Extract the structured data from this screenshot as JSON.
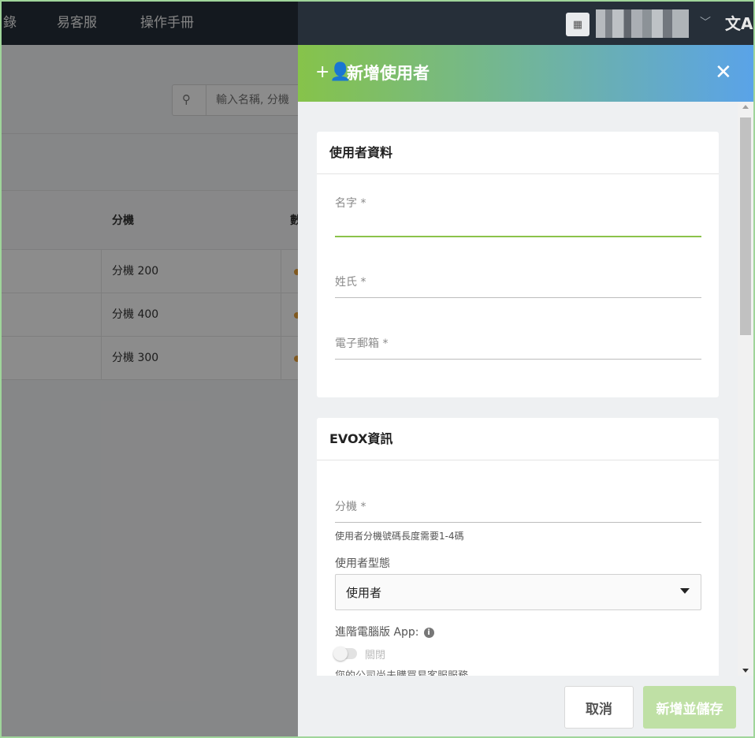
{
  "nav": {
    "items": [
      "錄",
      "易客服",
      "操作手冊"
    ],
    "company_icon": "building-icon",
    "translate_icon": "translate-icon"
  },
  "background": {
    "search_placeholder": "輸入名稱, 分機",
    "table_header": "分機",
    "table_header_2": "數",
    "rows": [
      "分機 200",
      "分機 400",
      "分機 300"
    ]
  },
  "drawer": {
    "title": "新增使用者",
    "user_card": {
      "title": "使用者資料",
      "first_name_label": "名字 *",
      "last_name_label": "姓氏 *",
      "email_label": "電子郵箱 *"
    },
    "evox_card": {
      "title": "EVOX資訊",
      "extension_label": "分機 *",
      "extension_hint": "使用者分機號碼長度需要1-4碼",
      "user_type_label": "使用者型態",
      "user_type_value": "使用者",
      "app_label": "進階電腦版 App:",
      "toggle_label": "關閉",
      "notice": "您的公司尚未購買易客服服務。"
    },
    "footer": {
      "cancel_label": "取消",
      "save_label": "新增並儲存"
    }
  },
  "colors": {
    "nav_bg": "#262f39",
    "accent_green": "#8bc34a",
    "accent_blue": "#5aa3e8",
    "save_disabled": "#bfe0a5"
  }
}
